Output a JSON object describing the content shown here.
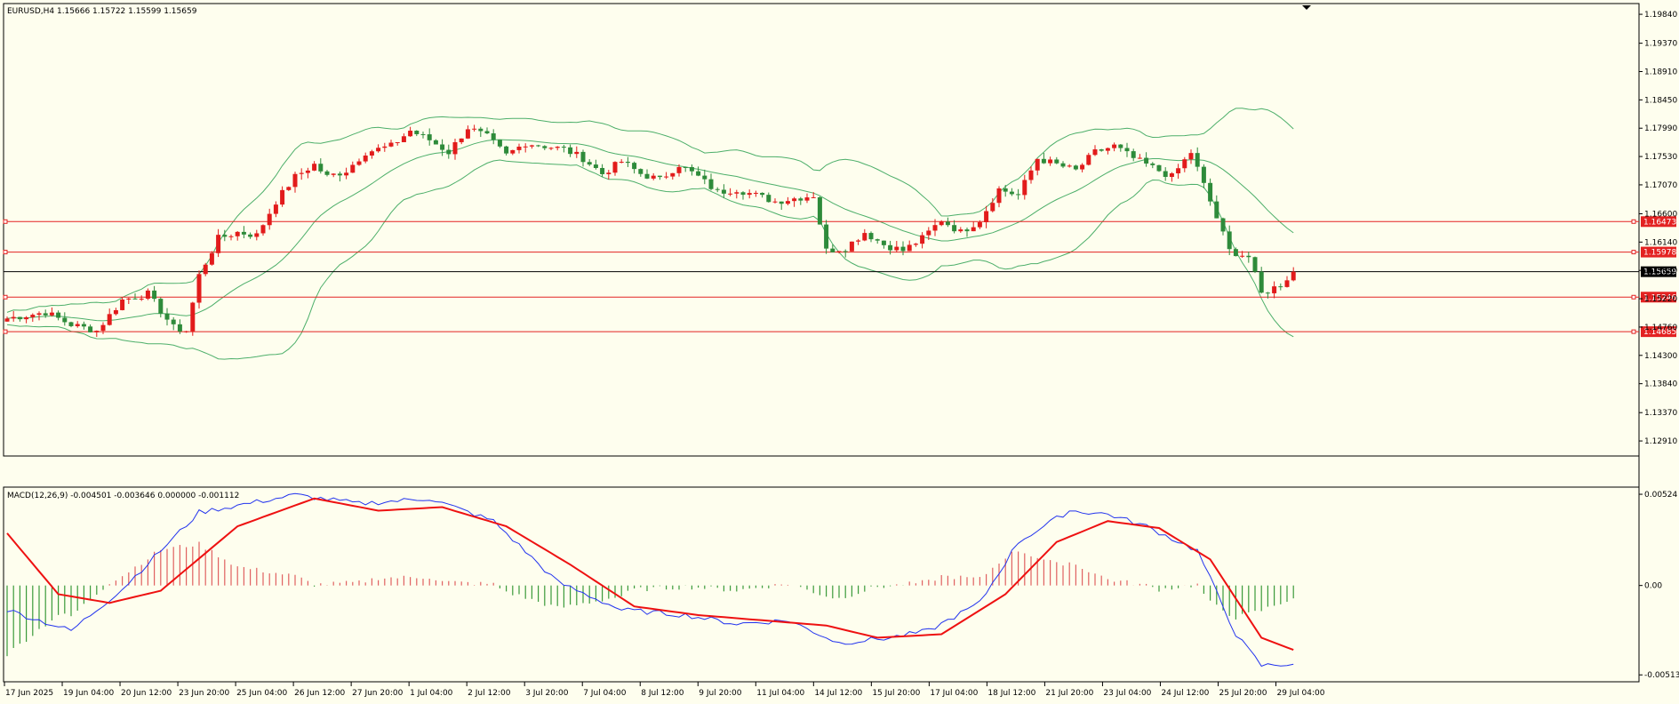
{
  "main": {
    "header": "EURUSD,H4  1.15666 1.15722 1.15599 1.15659",
    "price_scale": [
      "1.19840",
      "1.19370",
      "1.18910",
      "1.18450",
      "1.17990",
      "1.17530",
      "1.17070",
      "1.16600",
      "1.16140",
      "1.15680",
      "1.15220",
      "1.14760",
      "1.14300",
      "1.13840",
      "1.13370",
      "1.12910"
    ],
    "current_price": "1.15659"
  },
  "macd": {
    "header": "MACD(12,26,9) -0.004501 -0.003646 0.000000 -0.001112",
    "scale": [
      "0.00524",
      "0.00",
      "-0.005135"
    ]
  },
  "time_axis": [
    "17 Jun 2025",
    "19 Jun 04:00",
    "20 Jun 12:00",
    "23 Jun 20:00",
    "25 Jun 04:00",
    "26 Jun 12:00",
    "27 Jun 20:00",
    "1 Jul 04:00",
    "2 Jul 12:00",
    "3 Jul 20:00",
    "7 Jul 04:00",
    "8 Jul 12:00",
    "9 Jul 20:00",
    "11 Jul 04:00",
    "14 Jul 12:00",
    "15 Jul 20:00",
    "17 Jul 04:00",
    "18 Jul 12:00",
    "21 Jul 20:00",
    "23 Jul 04:00",
    "24 Jul 12:00",
    "25 Jul 20:00",
    "29 Jul 04:00"
  ],
  "colors": {
    "background": "#fefeee",
    "bull": "#e21b1b",
    "bear": "#2e8b3a",
    "band": "#4daf6a",
    "level": "#e32222",
    "macd_line": "#2233ee",
    "signal_line": "#ee1111",
    "hist_pos": "#e06060",
    "hist_neg": "#3a9a3a"
  },
  "chart_data": [
    {
      "type": "candlestick",
      "title": "EURUSD,H4",
      "ylim": [
        1.1268,
        1.2
      ],
      "levels": [
        1.16473,
        1.15978,
        1.15246,
        1.14685
      ],
      "level_labels": [
        "1.16473",
        "1.15978",
        "1.15246",
        "1.14685"
      ],
      "current": 1.15659,
      "price_keypoints": [
        [
          0,
          1.149
        ],
        [
          6,
          1.15
        ],
        [
          10,
          1.148
        ],
        [
          14,
          1.147
        ],
        [
          18,
          1.152
        ],
        [
          22,
          1.153
        ],
        [
          26,
          1.1475
        ],
        [
          28,
          1.147
        ],
        [
          30,
          1.156
        ],
        [
          33,
          1.162
        ],
        [
          36,
          1.163
        ],
        [
          39,
          1.1625
        ],
        [
          42,
          1.168
        ],
        [
          45,
          1.172
        ],
        [
          48,
          1.174
        ],
        [
          50,
          1.172
        ],
        [
          53,
          1.173
        ],
        [
          56,
          1.176
        ],
        [
          60,
          1.177
        ],
        [
          63,
          1.1795
        ],
        [
          66,
          1.178
        ],
        [
          69,
          1.176
        ],
        [
          72,
          1.18
        ],
        [
          75,
          1.1785
        ],
        [
          78,
          1.1755
        ],
        [
          81,
          1.1775
        ],
        [
          84,
          1.177
        ],
        [
          87,
          1.1765
        ],
        [
          90,
          1.175
        ],
        [
          93,
          1.1725
        ],
        [
          96,
          1.1745
        ],
        [
          99,
          1.1725
        ],
        [
          102,
          1.1715
        ],
        [
          105,
          1.174
        ],
        [
          108,
          1.172
        ],
        [
          111,
          1.1695
        ],
        [
          114,
          1.17
        ],
        [
          117,
          1.169
        ],
        [
          120,
          1.168
        ],
        [
          123,
          1.1685
        ],
        [
          126,
          1.169
        ],
        [
          128,
          1.16
        ],
        [
          131,
          1.1605
        ],
        [
          134,
          1.163
        ],
        [
          137,
          1.161
        ],
        [
          140,
          1.16
        ],
        [
          143,
          1.162
        ],
        [
          146,
          1.165
        ],
        [
          149,
          1.163
        ],
        [
          152,
          1.165
        ],
        [
          155,
          1.17
        ],
        [
          158,
          1.169
        ],
        [
          161,
          1.175
        ],
        [
          164,
          1.174
        ],
        [
          167,
          1.173
        ],
        [
          170,
          1.176
        ],
        [
          173,
          1.177
        ],
        [
          176,
          1.175
        ],
        [
          179,
          1.1735
        ],
        [
          182,
          1.172
        ],
        [
          185,
          1.176
        ],
        [
          188,
          1.168
        ],
        [
          191,
          1.16
        ],
        [
          194,
          1.159
        ],
        [
          196,
          1.153
        ],
        [
          199,
          1.1545
        ],
        [
          201,
          1.1566
        ]
      ],
      "candles_count": 202
    },
    {
      "type": "macd",
      "title": "MACD(12,26,9)",
      "ylim": [
        -0.00548,
        0.0056
      ],
      "macd_keypoints": [
        [
          0,
          -0.0014
        ],
        [
          10,
          -0.0026
        ],
        [
          18,
          -0.0002
        ],
        [
          30,
          0.0042
        ],
        [
          45,
          0.0052
        ],
        [
          55,
          0.0047
        ],
        [
          66,
          0.005
        ],
        [
          76,
          0.0037
        ],
        [
          86,
          0.0002
        ],
        [
          96,
          -0.0014
        ],
        [
          106,
          -0.0017
        ],
        [
          114,
          -0.0022
        ],
        [
          122,
          -0.002
        ],
        [
          130,
          -0.0033
        ],
        [
          138,
          -0.003
        ],
        [
          144,
          -0.0026
        ],
        [
          152,
          -0.001
        ],
        [
          158,
          0.0025
        ],
        [
          166,
          0.0043
        ],
        [
          172,
          0.0041
        ],
        [
          178,
          0.0034
        ],
        [
          186,
          0.002
        ],
        [
          192,
          -0.0028
        ],
        [
          196,
          -0.0046
        ],
        [
          201,
          -0.0045
        ]
      ],
      "signal_keypoints": [
        [
          0,
          0.003
        ],
        [
          8,
          -0.0005
        ],
        [
          16,
          -0.001
        ],
        [
          24,
          -0.0003
        ],
        [
          36,
          0.0034
        ],
        [
          48,
          0.005
        ],
        [
          58,
          0.0043
        ],
        [
          68,
          0.0045
        ],
        [
          78,
          0.0034
        ],
        [
          88,
          0.0012
        ],
        [
          98,
          -0.0012
        ],
        [
          108,
          -0.0017
        ],
        [
          118,
          -0.002
        ],
        [
          128,
          -0.0023
        ],
        [
          136,
          -0.003
        ],
        [
          146,
          -0.0028
        ],
        [
          156,
          -0.0005
        ],
        [
          164,
          0.0025
        ],
        [
          172,
          0.0037
        ],
        [
          180,
          0.0033
        ],
        [
          188,
          0.0015
        ],
        [
          196,
          -0.003
        ],
        [
          201,
          -0.0037
        ]
      ]
    }
  ]
}
